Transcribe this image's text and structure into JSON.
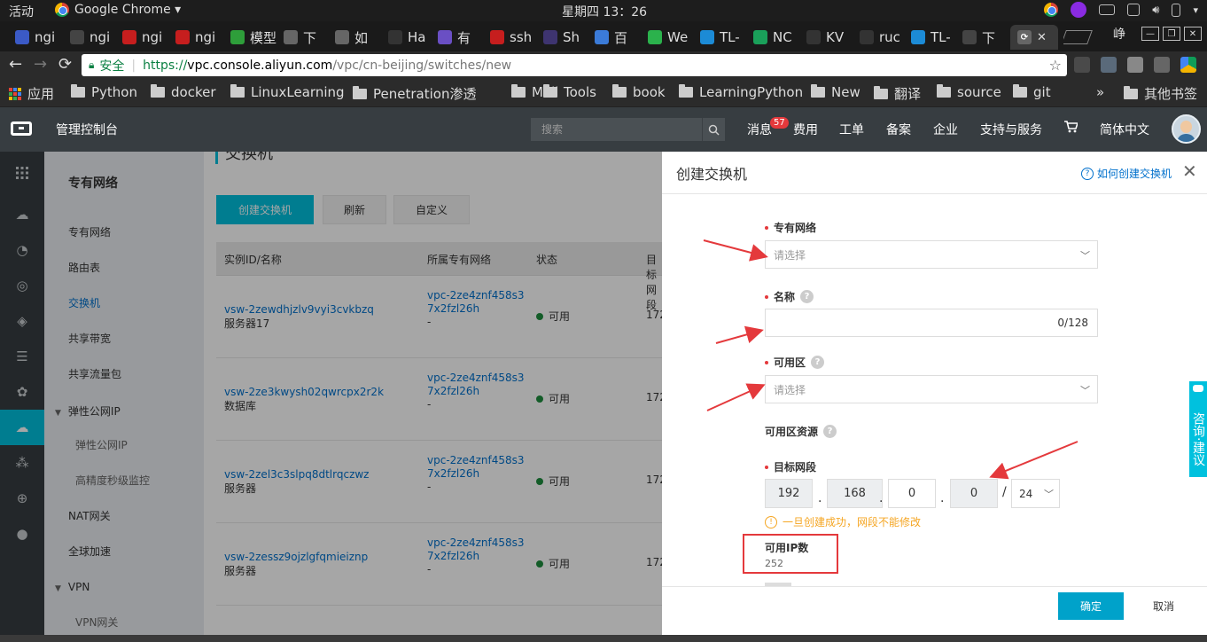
{
  "system": {
    "activities": "活动",
    "app_name": "Google Chrome ▾",
    "clock": "星期四 13：26"
  },
  "tabs": [
    {
      "label": "ngi",
      "fav_color": "#3b5ac6"
    },
    {
      "label": "ngi",
      "fav_color": "#444444"
    },
    {
      "label": "ngi",
      "fav_color": "#c61e1e"
    },
    {
      "label": "ngi",
      "fav_color": "#c61e1e"
    },
    {
      "label": "模型",
      "fav_color": "#2e9e3a"
    },
    {
      "label": "下",
      "fav_color": "#666666"
    },
    {
      "label": "如",
      "fav_color": "#666666"
    },
    {
      "label": "Ha",
      "fav_color": "#333333"
    },
    {
      "label": "有",
      "fav_color": "#6a4fc4"
    },
    {
      "label": "ssh",
      "fav_color": "#c61e1e"
    },
    {
      "label": "Sh",
      "fav_color": "#3e3470"
    },
    {
      "label": "百",
      "fav_color": "#3b7bd8"
    },
    {
      "label": "We",
      "fav_color": "#2bb24c"
    },
    {
      "label": "TL-",
      "fav_color": "#1c8bd6"
    },
    {
      "label": "NC",
      "fav_color": "#1aa05a"
    },
    {
      "label": "KV",
      "fav_color": "#333333"
    },
    {
      "label": "ruc",
      "fav_color": "#333333"
    },
    {
      "label": "TL-",
      "fav_color": "#1c8bd6"
    },
    {
      "label": "下",
      "fav_color": "#444444"
    }
  ],
  "window": {
    "user_label": "峥"
  },
  "address": {
    "secure_label": "安全",
    "url_https": "https://",
    "url_host": "vpc.console.aliyun.com",
    "url_path": "/vpc/cn-beijing/switches/new"
  },
  "bookmarks": {
    "apps": "应用",
    "items": [
      "Python",
      "docker",
      "LinuxLearning",
      "Penetration渗透",
      "Mail",
      "Tools",
      "book",
      "LearningPython",
      "New",
      "翻译",
      "source",
      "git"
    ],
    "more": "»",
    "other": "其他书签"
  },
  "console": {
    "title": "管理控制台",
    "search_placeholder": "搜索",
    "nav": [
      {
        "label": "消息",
        "badge": "57"
      },
      {
        "label": "费用"
      },
      {
        "label": "工单"
      },
      {
        "label": "备案"
      },
      {
        "label": "企业"
      },
      {
        "label": "支持与服务"
      },
      {
        "label": "简体中文"
      }
    ]
  },
  "sidebar": {
    "title": "专有网络",
    "items": [
      {
        "label": "专有网络",
        "active": false
      },
      {
        "label": "路由表",
        "active": false
      },
      {
        "label": "交换机",
        "active": true
      },
      {
        "label": "共享带宽",
        "active": false
      },
      {
        "label": "共享流量包",
        "active": false
      },
      {
        "label": "弹性公网IP",
        "group": true
      },
      {
        "label": "弹性公网IP",
        "child": true
      },
      {
        "label": "高精度秒级监控",
        "child": true
      },
      {
        "label": "NAT网关",
        "active": false
      },
      {
        "label": "全球加速",
        "active": false
      },
      {
        "label": "VPN",
        "group": true
      },
      {
        "label": "VPN网关",
        "child": true
      }
    ]
  },
  "main": {
    "heading": "交换机",
    "buttons": {
      "create": "创建交换机",
      "refresh": "刷新",
      "custom": "自定义"
    },
    "table": {
      "headers": [
        "实例ID/名称",
        "所属专有网络",
        "状态",
        "目标网段"
      ],
      "rows": [
        {
          "id": "vsw-2zewdhjzlv9vyi3cvkbzq",
          "name": "服务器17",
          "vpc": "vpc-2ze4znf458s37x2fzl26h",
          "vpc_sub": "-",
          "status": "可用",
          "target": "172"
        },
        {
          "id": "vsw-2ze3kwysh02qwrcpx2r2k",
          "name": "数据库",
          "vpc": "vpc-2ze4znf458s37x2fzl26h",
          "vpc_sub": "-",
          "status": "可用",
          "target": "172"
        },
        {
          "id": "vsw-2zel3c3slpq8dtlrqczwz",
          "name": "服务器",
          "vpc": "vpc-2ze4znf458s37x2fzl26h",
          "vpc_sub": "-",
          "status": "可用",
          "target": "172"
        },
        {
          "id": "vsw-2zessz9ojzlgfqmieiznp",
          "name": "服务器",
          "vpc": "vpc-2ze4znf458s37x2fzl26h",
          "vpc_sub": "-",
          "status": "可用",
          "target": "172"
        }
      ]
    }
  },
  "panel": {
    "title": "创建交换机",
    "help_link": "如何创建交换机",
    "fields": {
      "vpc": {
        "label": "专有网络",
        "placeholder": "请选择"
      },
      "name": {
        "label": "名称",
        "counter": "0/128"
      },
      "zone": {
        "label": "可用区",
        "placeholder": "请选择"
      },
      "zone_resources": {
        "label": "可用区资源"
      },
      "cidr": {
        "label": "目标网段",
        "octets": [
          "192",
          "168",
          "0",
          "0"
        ],
        "mask": "24",
        "warning": "一旦创建成功，网段不能修改"
      },
      "ip_count": {
        "label": "可用IP数",
        "value": "252"
      }
    },
    "footer": {
      "ok": "确定",
      "cancel": "取消"
    }
  },
  "side_float": {
    "label": "咨询·建议"
  },
  "colors": {
    "accent": "#00c1de",
    "primary_button": "#00a2ca",
    "annotation_red": "#e4393c",
    "link": "#0070cc"
  }
}
